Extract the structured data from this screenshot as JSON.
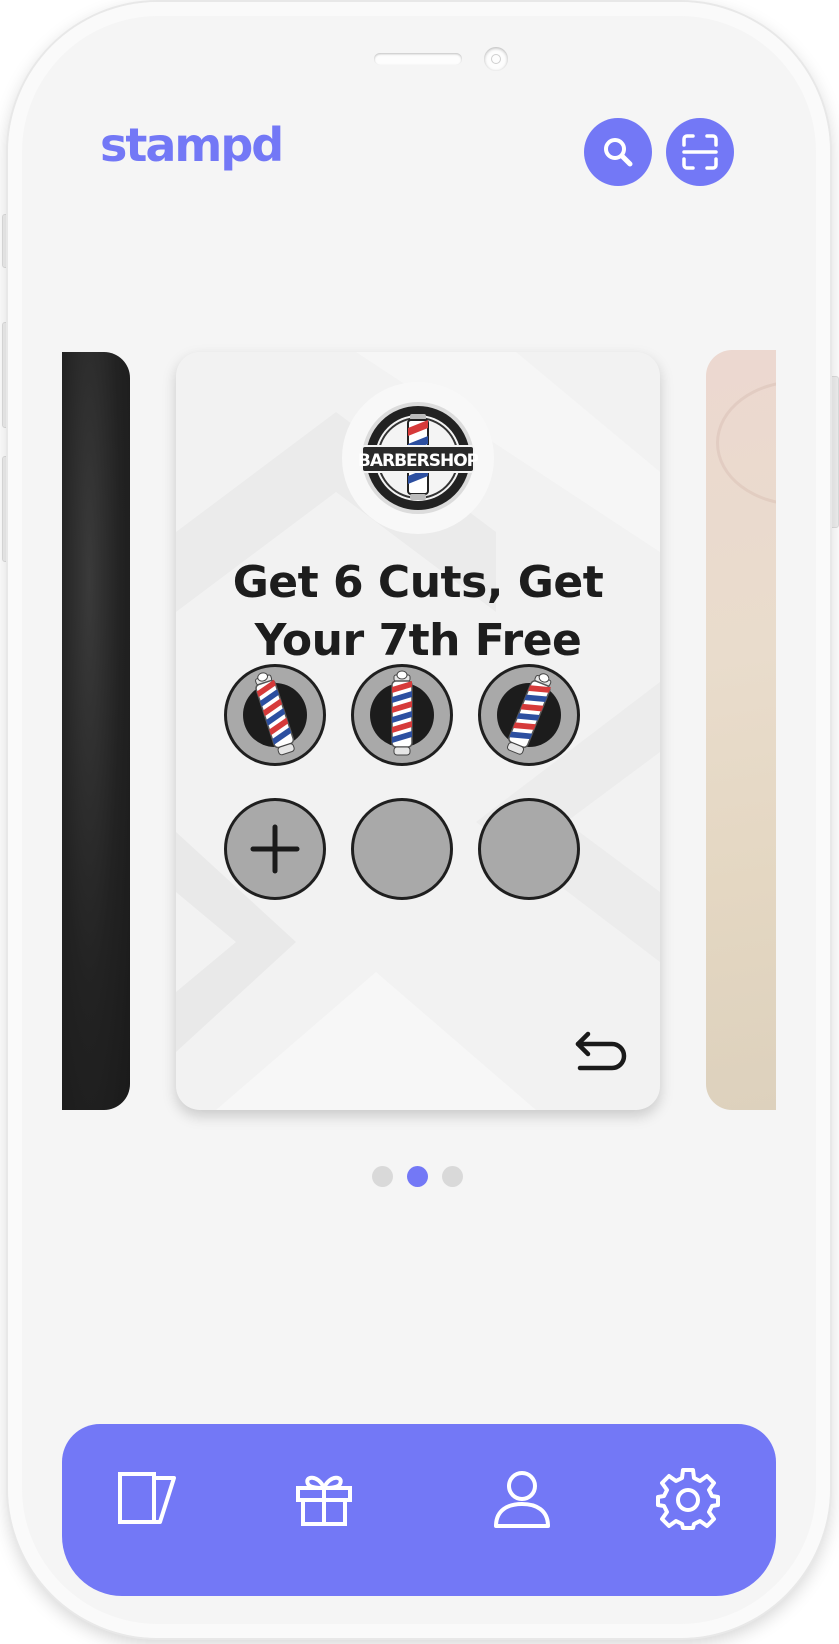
{
  "app": {
    "logo_text": "stampd",
    "brand_color": "#7378f6"
  },
  "header": {
    "search_icon": "search-icon",
    "scan_icon": "scan-qr-icon"
  },
  "card": {
    "business_logo_text": "BARBERSHOP",
    "title_line1": "Get 6 Cuts, Get",
    "title_line2": "Your 7th Free",
    "stamps_total": 6,
    "stamps_collected": 3,
    "stamp_icon": "barber-pole-icon",
    "next_stamp_icon": "plus-icon",
    "undo_icon": "undo-icon"
  },
  "carousel": {
    "page_count": 3,
    "active_index": 1
  },
  "bottom_nav": {
    "items": [
      {
        "icon": "cards-icon"
      },
      {
        "icon": "gift-icon"
      },
      {
        "icon": "user-icon"
      },
      {
        "icon": "gear-icon"
      }
    ]
  }
}
